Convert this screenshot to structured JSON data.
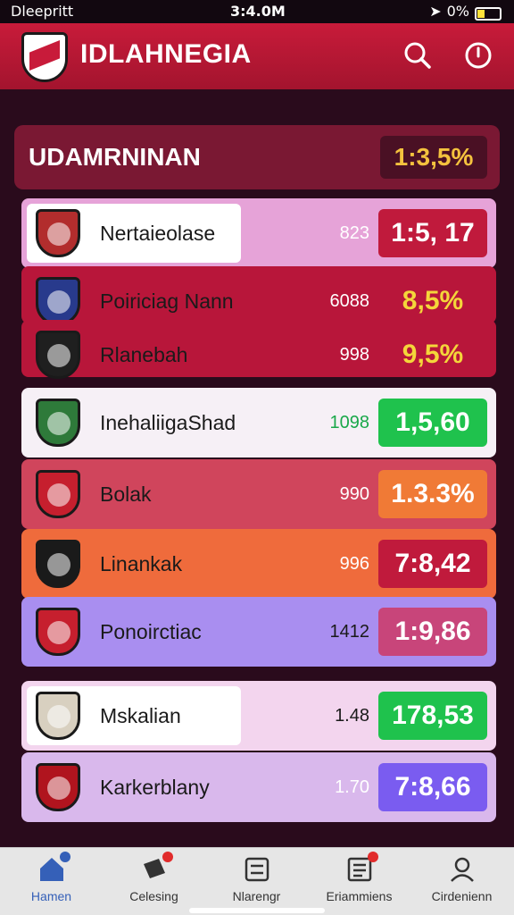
{
  "status_bar": {
    "carrier": "Dleepritt",
    "time": "3:4.0M",
    "battery": "0%"
  },
  "header": {
    "title": "IDLAHNEGIA",
    "search_icon": "search-icon",
    "power_icon": "power-icon"
  },
  "summary": {
    "title": "UDAMRNINAN",
    "value": "1:3,5%"
  },
  "rows": [
    {
      "name": "Nertaieolase",
      "count": "823",
      "odds": "1:5, 17",
      "bg": "#e6a3d8",
      "crest": "#b22d2d",
      "count_color": "#ffffff",
      "odds_bg": "#c01a3c",
      "odds_color": "#ffffff",
      "highlight": true
    },
    {
      "name": "Poiriciag Nann",
      "count": "6088",
      "odds": "8,5%",
      "bg": "#b8163a",
      "crest": "#283a8c",
      "count_color": "#ffffff",
      "odds_bg": "transparent",
      "odds_color": "#f4d63a",
      "highlight": false
    },
    {
      "name": "Rlanebah",
      "count": "998",
      "odds": "9,5%",
      "bg": "#b8163a",
      "crest": "#1f1f1f",
      "count_color": "#ffffff",
      "odds_bg": "transparent",
      "odds_color": "#f4d63a",
      "highlight": false
    },
    {
      "name": "InehaliigaShad",
      "count": "1098",
      "odds": "1,5,60",
      "bg": "#f6f0f6",
      "crest": "#2e7a3a",
      "count_color": "#1aa84a",
      "odds_bg": "#1fc24d",
      "odds_color": "#ffffff",
      "highlight": false
    },
    {
      "name": "Bolak",
      "count": "990",
      "odds": "1.3.3%",
      "bg": "#d0455c",
      "crest": "#c61f2e",
      "count_color": "#ffffff",
      "odds_bg": "#f07a36",
      "odds_color": "#ffffff",
      "highlight": false
    },
    {
      "name": "Linankak",
      "count": "996",
      "odds": "7:8,42",
      "bg": "#ef6b3c",
      "crest": "#1a1a1a",
      "count_color": "#ffffff",
      "odds_bg": "#c01a3c",
      "odds_color": "#ffffff",
      "highlight": false
    },
    {
      "name": "Ponoirctiac",
      "count": "1412",
      "odds": "1:9,86",
      "bg": "#a98ef0",
      "crest": "#c61f2e",
      "count_color": "#1a1a1a",
      "odds_bg": "#c8457a",
      "odds_color": "#ffffff",
      "highlight": false
    },
    {
      "name": "Mskalian",
      "count": "1.48",
      "odds": "178,53",
      "bg": "#f3d5ee",
      "crest": "#d8d0c0",
      "count_color": "#1a1a1a",
      "odds_bg": "#1fc24d",
      "odds_color": "#ffffff",
      "highlight": true
    },
    {
      "name": "Karkerblany",
      "count": "1.70",
      "odds": "7:8,66",
      "bg": "#d9b8ec",
      "crest": "#b0141e",
      "count_color": "#ffffff",
      "odds_bg": "#7a5cf0",
      "odds_color": "#ffffff",
      "highlight": false
    }
  ],
  "nav": [
    {
      "label": "Hamen",
      "icon": "home-icon",
      "active": true,
      "dot": "blue"
    },
    {
      "label": "Celesing",
      "icon": "ticket-icon",
      "active": false,
      "dot": "red"
    },
    {
      "label": "Nlarengr",
      "icon": "calculator-icon",
      "active": false,
      "dot": ""
    },
    {
      "label": "Eriammiens",
      "icon": "document-icon",
      "active": false,
      "dot": "red"
    },
    {
      "label": "Cirdenienn",
      "icon": "profile-icon",
      "active": false,
      "dot": ""
    }
  ]
}
